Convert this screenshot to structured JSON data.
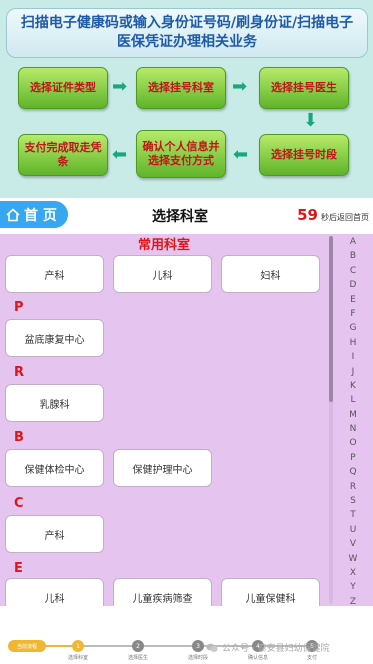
{
  "guide": {
    "banner": "扫描电子健康码或输入身份证号码/刷身份证/扫描电子医保凭证办理相关业务",
    "steps": [
      "选择证件类型",
      "选择挂号科室",
      "选择挂号医生",
      "选择挂号时段",
      "确认个人信息并选择支付方式",
      "支付完成取走凭条"
    ]
  },
  "header": {
    "home_label": "首 页",
    "title": "选择科室",
    "countdown_value": "59",
    "countdown_text": "秒后返回首页"
  },
  "content": {
    "common_title": "常用科室",
    "common": [
      "产科",
      "儿科",
      "妇科"
    ],
    "sections": [
      {
        "letter": "P",
        "items": [
          "盆底康复中心"
        ]
      },
      {
        "letter": "R",
        "items": [
          "乳腺科"
        ]
      },
      {
        "letter": "B",
        "items": [
          "保健体检中心",
          "保健护理中心"
        ]
      },
      {
        "letter": "C",
        "items": [
          "产科"
        ]
      },
      {
        "letter": "E",
        "items": [
          "儿科",
          "儿童疾病筛查",
          "儿童保健科"
        ]
      }
    ],
    "index_letters": [
      "A",
      "B",
      "C",
      "D",
      "E",
      "F",
      "G",
      "H",
      "I",
      "J",
      "K",
      "L",
      "M",
      "N",
      "O",
      "P",
      "Q",
      "R",
      "S",
      "T",
      "U",
      "V",
      "W",
      "X",
      "Y",
      "Z"
    ]
  },
  "footer": {
    "progress_label": "当前流程",
    "steps": [
      {
        "num": "1",
        "label": "选择科室"
      },
      {
        "num": "2",
        "label": "选择医生"
      },
      {
        "num": "3",
        "label": "选择时段"
      },
      {
        "num": "4",
        "label": "确认信息"
      },
      {
        "num": "5",
        "label": "支付"
      }
    ],
    "watermark": "公众号 · 泰安县妇幼保健院"
  }
}
